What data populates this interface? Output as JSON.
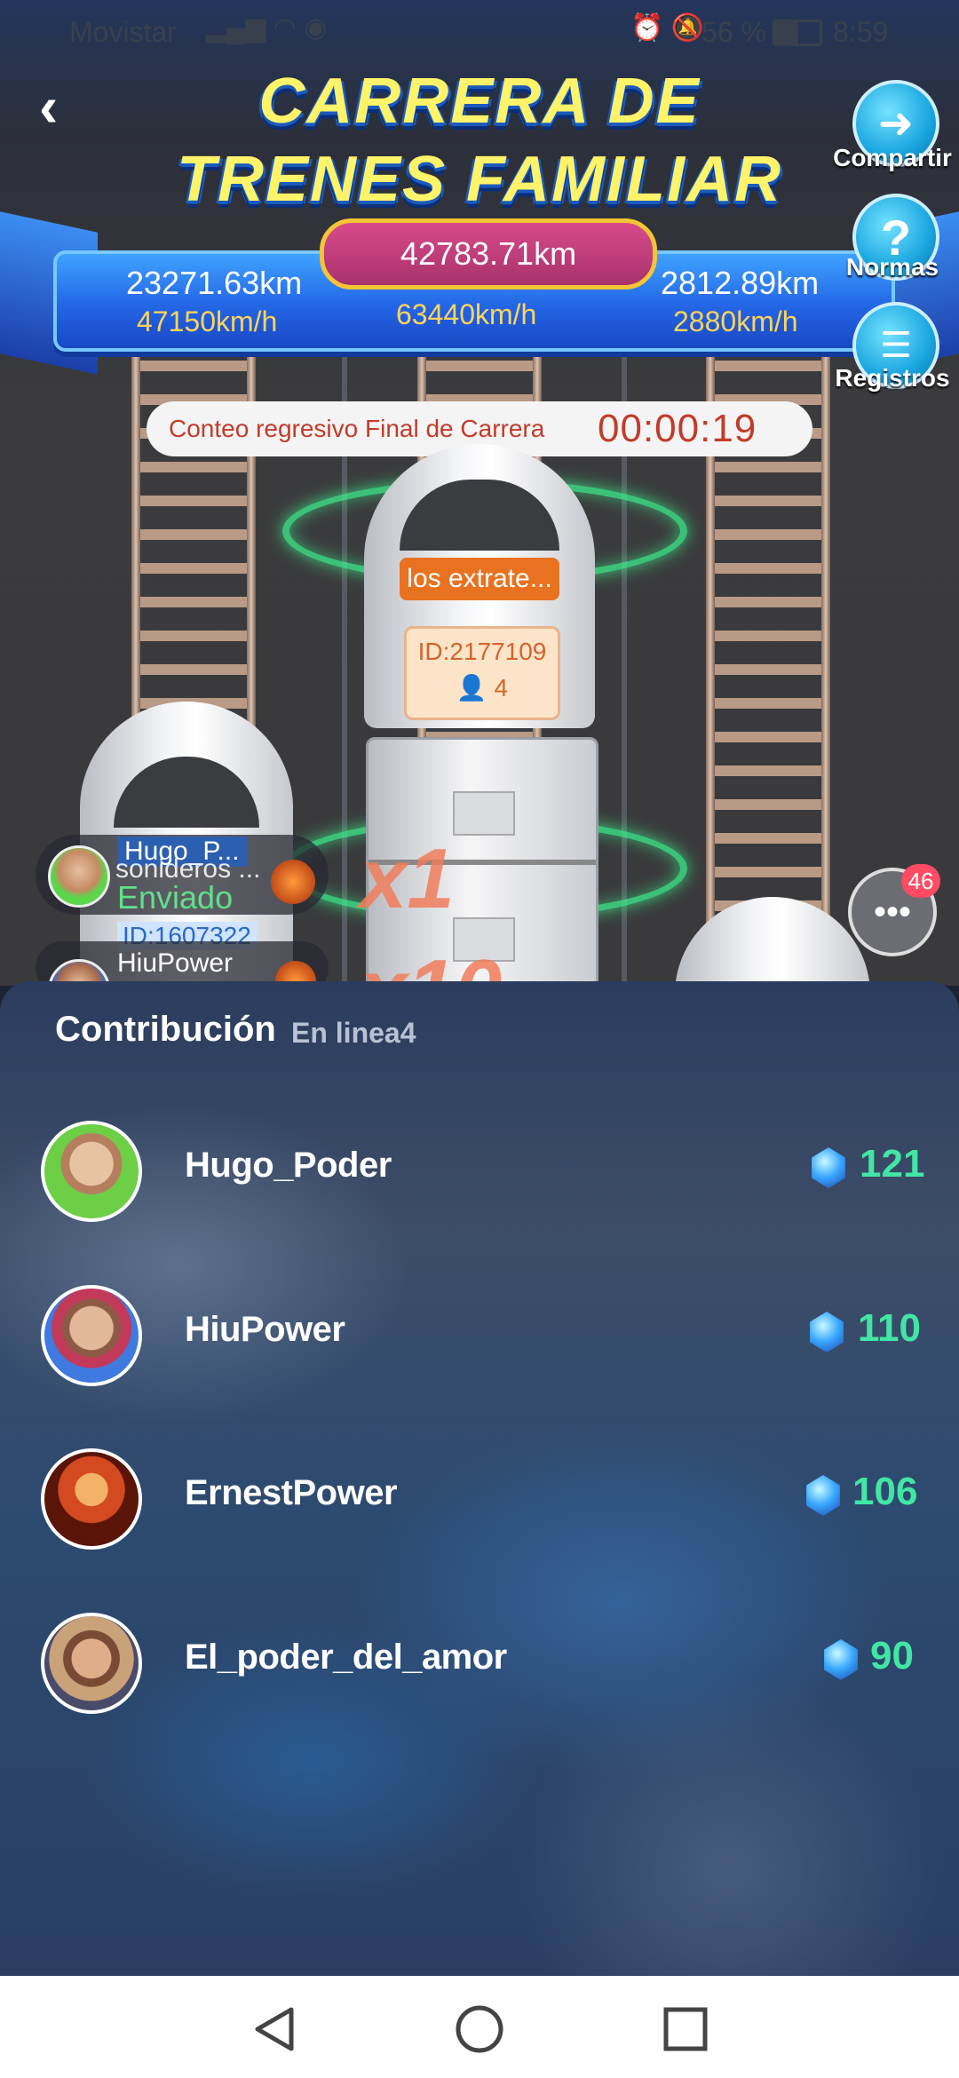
{
  "status_bar": {
    "carrier": "Movistar",
    "battery": "56 %",
    "time": "8:59"
  },
  "game": {
    "title_line1": "CARRERA DE",
    "title_line2": "TRENES FAMILIAR",
    "total_distance": "42783.71km",
    "left_distance": "23271.63km",
    "left_speed": "47150km/h",
    "center_speed": "63440km/h",
    "right_distance": "2812.89km",
    "right_speed": "2880km/h",
    "countdown_label": "Conteo regresivo Final de Carrera",
    "countdown_timer": "00:00:19",
    "train_name": "los extrate...",
    "train_id": "ID:2177109",
    "train_members": "4",
    "multiplier_1": "x1",
    "multiplier_2": "x10",
    "side_buttons": {
      "share": "Compartir",
      "rules": "Normas",
      "records": "Registros"
    },
    "chat_badge": "46",
    "notices": [
      {
        "user": "Hugo_P...",
        "line2": "sonideros ...",
        "action": "Enviado",
        "id": "ID:1607322"
      },
      {
        "user": "HiuPower"
      }
    ]
  },
  "contribution": {
    "title": "Contribución",
    "online_label": "En linea4",
    "entries": [
      {
        "name": "Hugo_Poder",
        "value": "121"
      },
      {
        "name": "HiuPower",
        "value": "110"
      },
      {
        "name": "ErnestPower",
        "value": "106"
      },
      {
        "name": "El_poder_del_amor",
        "value": "90"
      }
    ]
  },
  "colors": {
    "accent_green": "#42e6a4",
    "title_yellow": "#fff36a",
    "countdown_red": "#c23b2a",
    "train_label_orange": "#e8721f"
  }
}
